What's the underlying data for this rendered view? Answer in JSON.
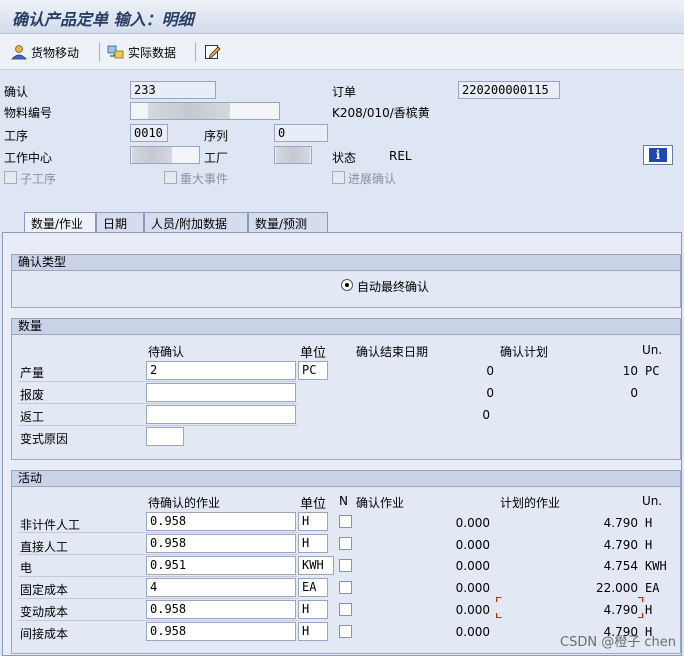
{
  "title": "确认产品定单 输入：明细",
  "toolbar": {
    "goods_move": "货物移动",
    "actual_data": "实际数据"
  },
  "header": {
    "confirm_label": "确认",
    "confirm_value": "233",
    "order_label": "订单",
    "order_value": "220200000115",
    "material_label": "物料编号",
    "material_desc": "K208/010/香槟黄",
    "operation_label": "工序",
    "operation_value": "0010",
    "sequence_label": "序列",
    "sequence_value": "0",
    "workcenter_label": "工作中心",
    "plant_label": "工厂",
    "status_label": "状态",
    "status_value": "REL",
    "sub_op_label": "子工序",
    "major_event_label": "重大事件",
    "progress_confirm_label": "进展确认"
  },
  "tabs": [
    "数量/作业",
    "日期",
    "人员/附加数据",
    "数量/预测"
  ],
  "confirm_type": {
    "header": "确认类型",
    "option": "自动最终确认"
  },
  "quantity": {
    "header": "数量",
    "col_pending": "待确认",
    "col_unit": "单位",
    "col_end_date": "确认结束日期",
    "col_plan": "确认计划",
    "col_un": "Un.",
    "rows": [
      {
        "label": "产量",
        "value": "2",
        "unit": "PC",
        "end_date": "0",
        "plan": "10",
        "un": "PC"
      },
      {
        "label": "报废",
        "value": "",
        "unit": "",
        "end_date": "0",
        "plan": "0",
        "un": ""
      },
      {
        "label": "返工",
        "value": "",
        "unit": "",
        "end_date": "0",
        "plan": "",
        "un": ""
      },
      {
        "label": "变式原因",
        "value": "",
        "unit": "",
        "end_date": "",
        "plan": "",
        "un": ""
      }
    ]
  },
  "activity": {
    "header": "活动",
    "col_pending": "待确认的作业",
    "col_unit": "单位",
    "col_n": "N",
    "col_confirm": "确认作业",
    "col_planned": "计划的作业",
    "col_un": "Un.",
    "rows": [
      {
        "label": "非计件人工",
        "value": "0.958",
        "unit": "H",
        "confirmed": "0.000",
        "planned": "4.790",
        "un": "H"
      },
      {
        "label": "直接人工",
        "value": "0.958",
        "unit": "H",
        "confirmed": "0.000",
        "planned": "4.790",
        "un": "H"
      },
      {
        "label": "电",
        "value": "0.951",
        "unit": "KWH",
        "confirmed": "0.000",
        "planned": "4.754",
        "un": "KWH"
      },
      {
        "label": "固定成本",
        "value": "4",
        "unit": "EA",
        "confirmed": "0.000",
        "planned": "22.000",
        "un": "EA"
      },
      {
        "label": "变动成本",
        "value": "0.958",
        "unit": "H",
        "confirmed": "0.000",
        "planned": "4.790",
        "un": "H"
      },
      {
        "label": "间接成本",
        "value": "0.958",
        "unit": "H",
        "confirmed": "0.000",
        "planned": "4.790",
        "un": "H"
      }
    ]
  },
  "watermark": "CSDN @橙子 chen"
}
